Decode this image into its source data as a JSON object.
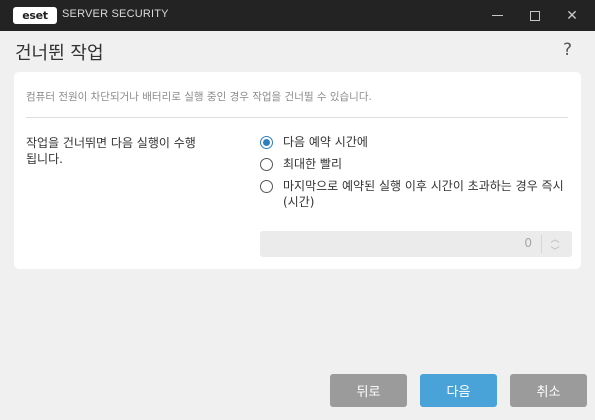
{
  "window": {
    "logo_text": "eset",
    "app_name": "SERVER SECURITY",
    "minimize_icon": "minimize-icon",
    "maximize_icon": "maximize-icon",
    "close_icon": "close-icon",
    "close_glyph": "✕"
  },
  "header": {
    "title": "건너뛴 작업",
    "help": "?"
  },
  "card": {
    "description": "컴퓨터 전원이 차단되거나 배터리로 실행 중인 경우 작업을 건너뛸 수 있습니다.",
    "question": "작업을 건너뛰면 다음 실행이 수행됩니다.",
    "options": [
      {
        "label": "다음 예약 시간에",
        "checked": true
      },
      {
        "label": "최대한 빨리",
        "checked": false
      },
      {
        "label": "마지막으로 예약된 실행 이후 시간이 초과하는 경우 즉시(시간)",
        "checked": false
      }
    ],
    "hours_value": "0",
    "hours_up": "︿",
    "hours_down": "﹀"
  },
  "footer": {
    "back_label": "뒤로",
    "next_label": "다음",
    "cancel_label": "취소"
  },
  "colors": {
    "accent": "#4aa3d8",
    "titlebar": "#232323",
    "neutral_button": "#9b9b9b"
  }
}
